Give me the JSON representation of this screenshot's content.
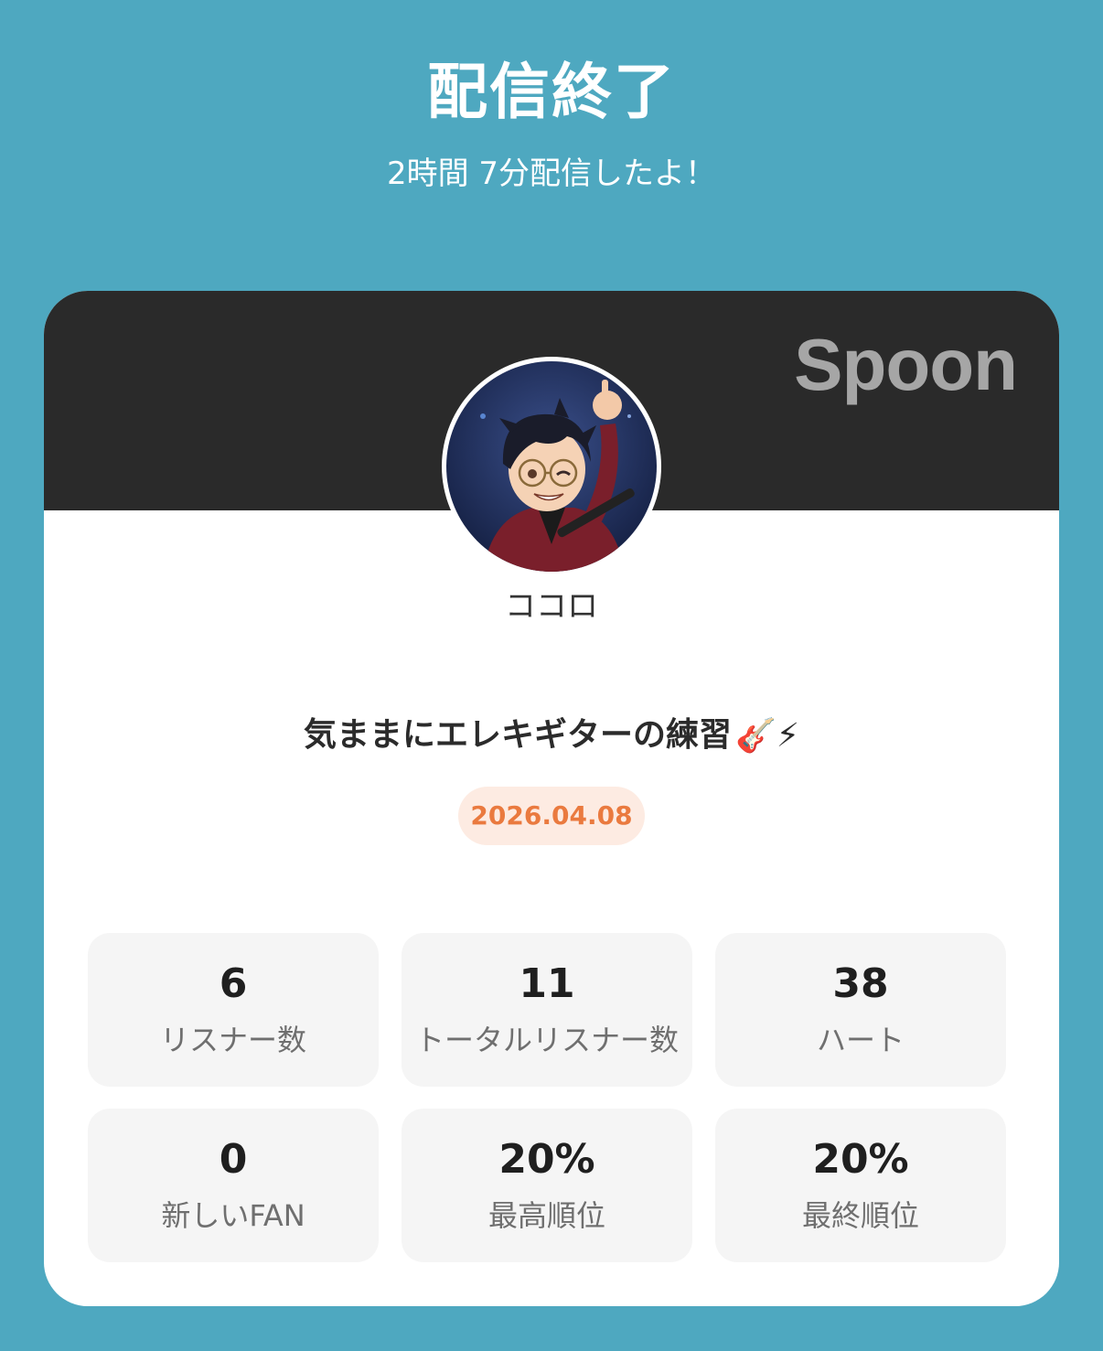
{
  "header": {
    "title": "配信終了",
    "subtitle": "2時間 7分配信したよ！"
  },
  "card": {
    "brand": "Spoon",
    "avatar_icon": "dj-avatar-image",
    "username": "ココロ",
    "broadcast_title": "気ままにエレキギターの練習",
    "title_emojis": "🎸⚡",
    "date": "2026.04.08",
    "colors": {
      "background": "#4ea8c0",
      "banner": "#2a2a2a",
      "date_badge_bg": "#fdebe2",
      "date_badge_text": "#ea7a3f",
      "stat_bg": "#f5f5f5"
    }
  },
  "stats": [
    {
      "value": "6",
      "label": "リスナー数"
    },
    {
      "value": "11",
      "label": "トータルリスナー数"
    },
    {
      "value": "38",
      "label": "ハート"
    },
    {
      "value": "0",
      "label": "新しいFAN"
    },
    {
      "value": "20%",
      "label": "最高順位"
    },
    {
      "value": "20%",
      "label": "最終順位"
    }
  ]
}
